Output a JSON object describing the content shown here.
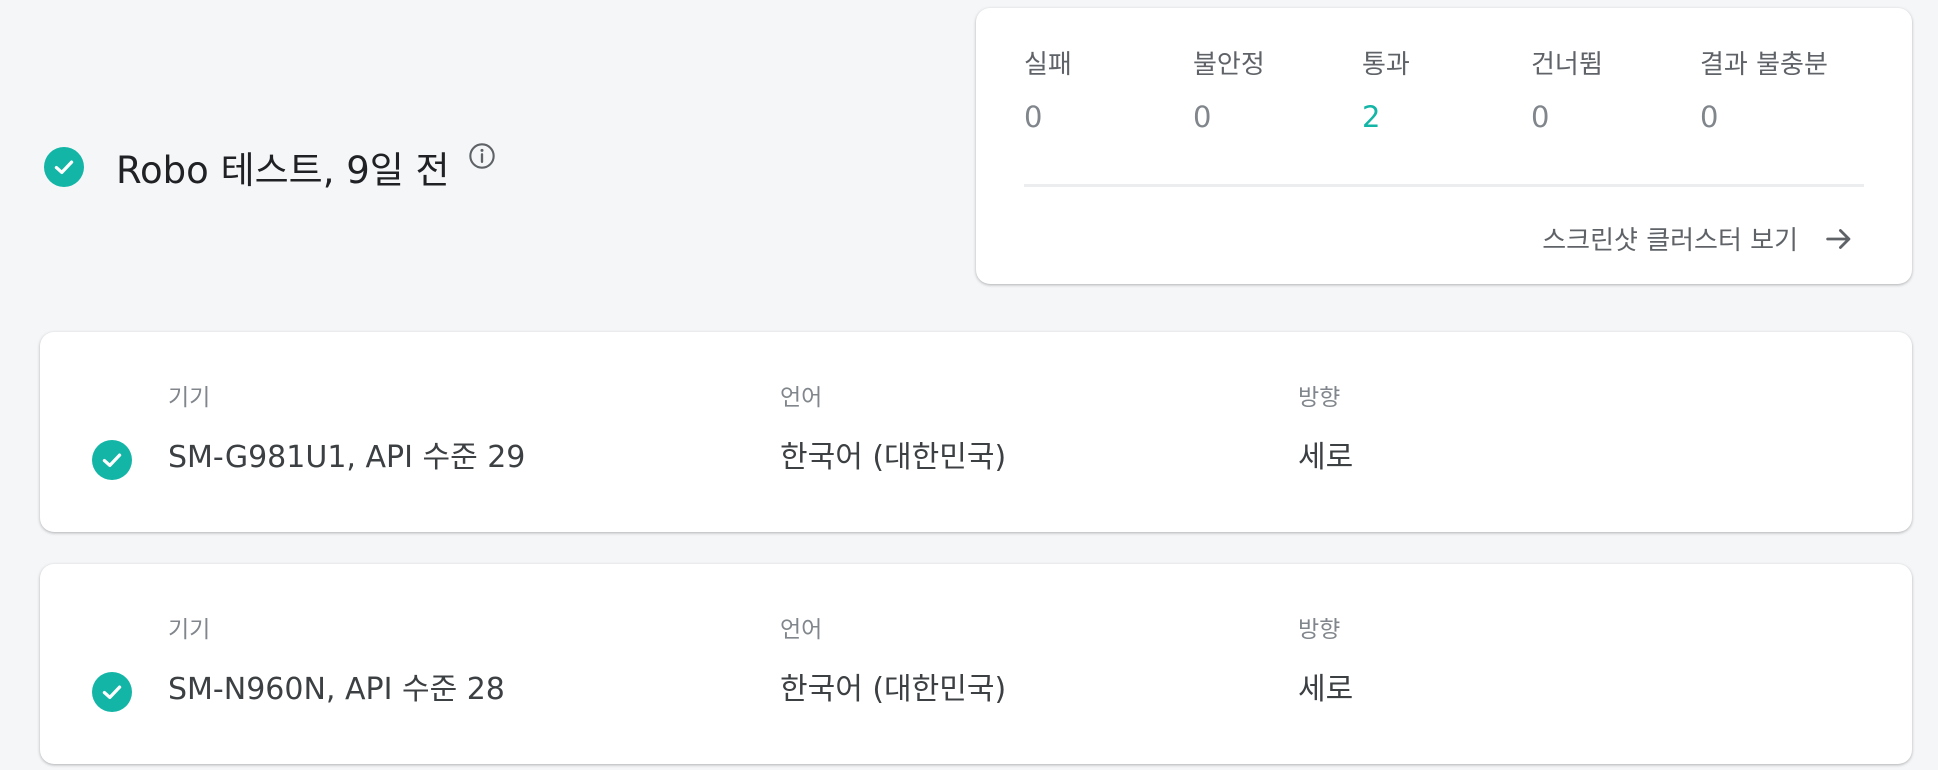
{
  "header": {
    "title": "Robo 테스트, 9일 전"
  },
  "summary": {
    "stats": [
      {
        "label": "실패",
        "value": "0"
      },
      {
        "label": "불안정",
        "value": "0"
      },
      {
        "label": "통과",
        "value": "2"
      },
      {
        "label": "건너뜀",
        "value": "0"
      },
      {
        "label": "결과 불충분",
        "value": "0"
      }
    ],
    "link_label": "스크린샷 클러스터 보기"
  },
  "devices": [
    {
      "device_label": "기기",
      "device_value": "SM-G981U1, API 수준 29",
      "language_label": "언어",
      "language_value": "한국어 (대한민국)",
      "orientation_label": "방향",
      "orientation_value": "세로",
      "status": "passed"
    },
    {
      "device_label": "기기",
      "device_value": "SM-N960N, API 수준 28",
      "language_label": "언어",
      "language_value": "한국어 (대한민국)",
      "orientation_label": "방향",
      "orientation_value": "세로",
      "status": "passed"
    }
  ],
  "icons": {
    "status": "check-circle-icon",
    "info": "info-icon",
    "link": "arrow-forward-icon"
  },
  "colors": {
    "pass": "#12b5a6",
    "background": "#f5f6f8",
    "card": "#ffffff"
  }
}
